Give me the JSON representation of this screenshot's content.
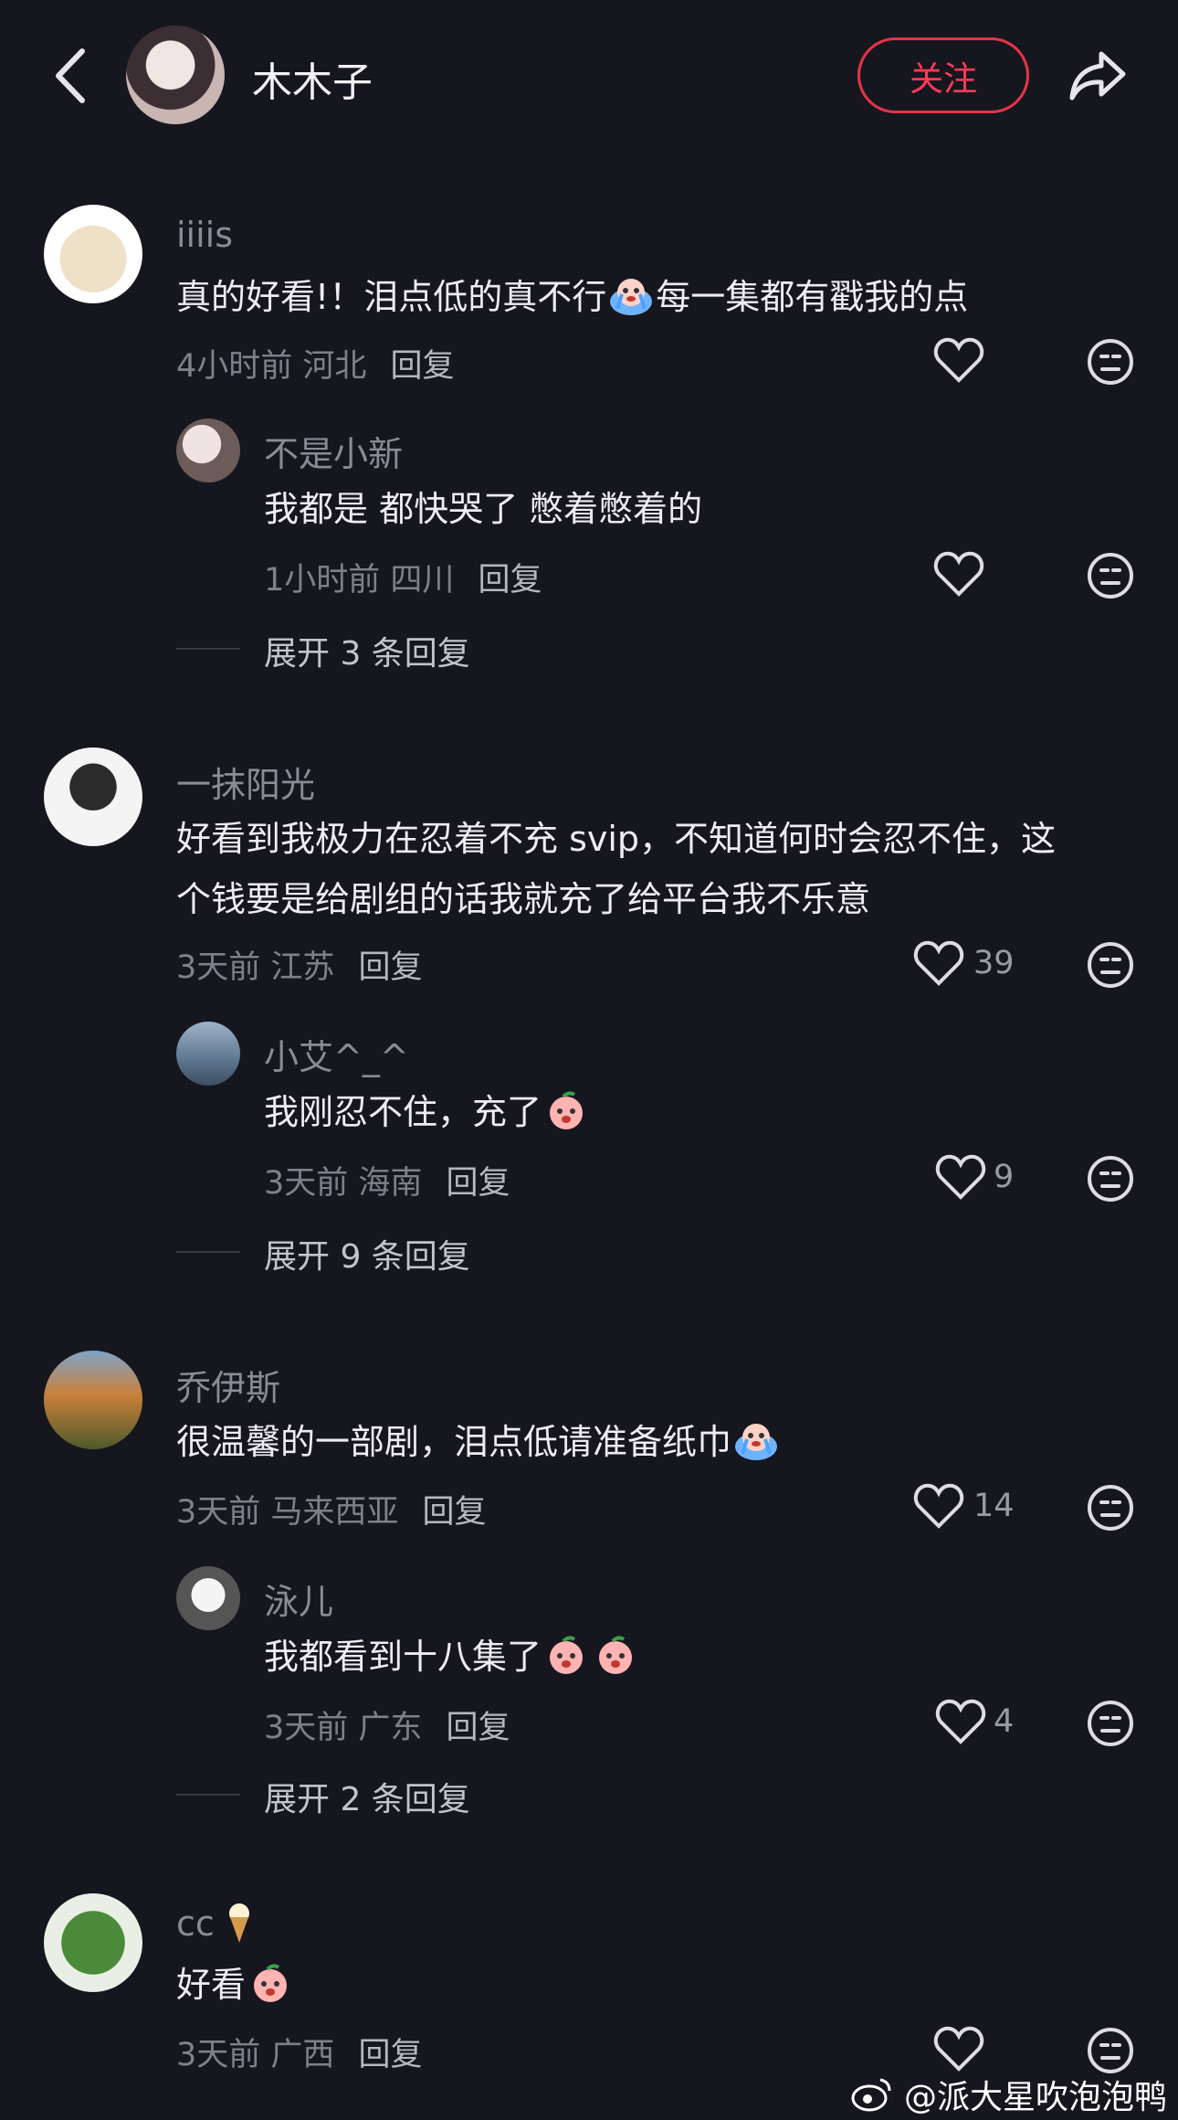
{
  "header": {
    "author": "木木子",
    "follow_label": "关注"
  },
  "comments": [
    {
      "user": "iiiis",
      "text_parts": [
        "真的好看!！泪点低的真不行",
        "每一集都有戳我的点"
      ],
      "time": "4小时前",
      "location": "河北",
      "reply_label": "回复",
      "likes": "",
      "reply": {
        "user": "不是小新",
        "text": "我都是 都快哭了 憋着憋着的",
        "time": "1小时前",
        "location": "四川",
        "reply_label": "回复",
        "likes": ""
      },
      "expand": "展开 3 条回复"
    },
    {
      "user": "一抹阳光",
      "text_line1": "好看到我极力在忍着不充 svip，不知道何时会忍不住，这",
      "text_line2": "个钱要是给剧组的话我就充了给平台我不乐意",
      "time": "3天前",
      "location": "江苏",
      "reply_label": "回复",
      "likes": "39",
      "reply": {
        "user": "小艾^_^",
        "text": "我刚忍不住，充了",
        "time": "3天前",
        "location": "海南",
        "reply_label": "回复",
        "likes": "9"
      },
      "expand": "展开 9 条回复"
    },
    {
      "user": "乔伊斯",
      "text": "很温馨的一部剧，泪点低请准备纸巾",
      "time": "3天前",
      "location": "马来西亚",
      "reply_label": "回复",
      "likes": "14",
      "reply": {
        "user": "泳儿",
        "text": "我都看到十八集了",
        "time": "3天前",
        "location": "广东",
        "reply_label": "回复",
        "likes": "4"
      },
      "expand": "展开 2 条回复"
    },
    {
      "user": "cc",
      "text": "好看",
      "time": "3天前",
      "location": "广西",
      "reply_label": "回复",
      "likes": ""
    }
  ],
  "watermark": "@派大星吹泡泡鸭",
  "colors": {
    "background": "#16161e",
    "follow_red": "#ff3b57"
  }
}
